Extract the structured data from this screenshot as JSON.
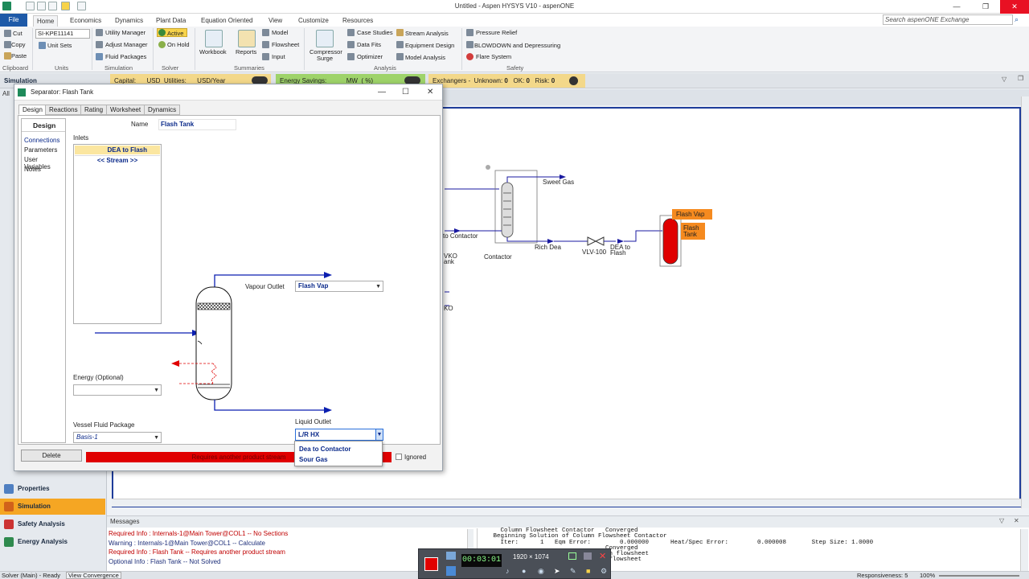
{
  "app": {
    "title": "Untitled - Aspen HYSYS V10 - aspenONE",
    "search_placeholder": "Search aspenONE Exchange"
  },
  "menu": {
    "tabs": [
      "File",
      "Home",
      "Economics",
      "Dynamics",
      "Plant Data",
      "Equation Oriented",
      "View",
      "Customize",
      "Resources"
    ]
  },
  "ribbon": {
    "clipboard": {
      "cut": "Cut",
      "copy": "Copy",
      "paste": "Paste",
      "group": "Clipboard"
    },
    "units": {
      "unit_set_value": "SI-KPE11141",
      "unit_sets": "Unit Sets",
      "group": "Units"
    },
    "simulation": {
      "utility_manager": "Utility Manager",
      "adjust_manager": "Adjust Manager",
      "fluid_packages": "Fluid Packages",
      "group": "Simulation"
    },
    "solver": {
      "active": "Active",
      "on_hold": "On Hold",
      "group": "Solver"
    },
    "summaries": {
      "workbook": "Workbook",
      "reports": "Reports",
      "model": "Model",
      "flowsheet": "Flowsheet",
      "input": "Input",
      "group": "Summaries"
    },
    "analysis": {
      "compressor": "Compressor",
      "surge": "Surge",
      "case_studies": "Case Studies",
      "data_fits": "Data Fits",
      "optimizer": "Optimizer",
      "stream_analysis": "Stream Analysis",
      "equipment_design": "Equipment Design",
      "model_analysis": "Model Analysis",
      "group": "Analysis"
    },
    "safety": {
      "pressure_relief": "Pressure Relief",
      "blowdown": "BLOWDOWN and Depressuring",
      "flare_system": "Flare System",
      "group": "Safety"
    }
  },
  "simbar": {
    "simulation": "Simulation",
    "capital": "Capital:",
    "capital_unit": "USD",
    "utilities": "Utilities:",
    "utilities_unit": "USD/Year",
    "energy_savings": "Energy Savings:",
    "energy_unit": "MW",
    "energy_pct": "(        %)",
    "exchangers": "Exchangers -",
    "unknown_label": "Unknown:",
    "unknown_val": "0",
    "ok_label": "OK:",
    "ok_val": "0",
    "risk_label": "Risk:",
    "risk_val": "0"
  },
  "leftnav": {
    "all": "All",
    "items": [
      "Properties",
      "Simulation",
      "Safety Analysis",
      "Energy Analysis"
    ]
  },
  "flowsheet": {
    "labels": {
      "sweet_gas": "Sweet Gas",
      "to_contactor": "to Contactor",
      "contactor": "Contactor",
      "rich_dea": "Rich Dea",
      "vlv": "VLV-100",
      "dea_to": "DEA to",
      "flash": "Flash",
      "flash_vap": "Flash Vap",
      "flash_tank_1": "Flash",
      "flash_tank_2": "Tank",
      "vko": "VKO",
      "ank": "ank",
      "ko": "KO"
    }
  },
  "dialog": {
    "title": "Separator: Flash Tank",
    "tabs": [
      "Design",
      "Reactions",
      "Rating",
      "Worksheet",
      "Dynamics"
    ],
    "nav_header": "Design",
    "nav_items": [
      "Connections",
      "Parameters",
      "User Variables",
      "Notes"
    ],
    "name_label": "Name",
    "name_value": "Flash Tank",
    "inlets_label": "Inlets",
    "inlets": [
      "DEA to Flash",
      "<< Stream >>"
    ],
    "vapour_outlet_label": "Vapour Outlet",
    "vapour_outlet_value": "Flash Vap",
    "energy_label": "Energy (Optional)",
    "energy_value": "",
    "fluid_package_label": "Vessel Fluid Package",
    "fluid_package_value": "Basis-1",
    "liquid_outlet_label": "Liquid Outlet",
    "liquid_outlet_value": "L/R HX",
    "dropdown_options": [
      "Dea to Contactor",
      "Sour Gas"
    ],
    "delete": "Delete",
    "status": "Requires another product stream",
    "ignored": "Ignored"
  },
  "messages": {
    "header": "Messages",
    "left": [
      {
        "text": "Required Info : Internals-1@Main Tower@COL1 -- No Sections",
        "kind": "red"
      },
      {
        "text": "Warning : Internals-1@Main Tower@COL1 -- Calculate",
        "kind": "normal"
      },
      {
        "text": "Required Info : Flash Tank -- Requires another product stream",
        "kind": "red"
      },
      {
        "text": "Optional Info : Flash Tank -- Not Solved",
        "kind": "normal"
      }
    ],
    "right": "     Column Flowsheet Contactor   Converged\n   Beginning Solution of Column Flowsheet Contactor\n     Iter:      1   Eqm Error:        0.000000      Heat/Spec Error:        0.000008       Step Size: 1.0000\n                                  Converged\n                       d on the Main flowsheet\n                       on the Main flowsheet"
  },
  "statusbar": {
    "solver": "Solver (Main) - Ready",
    "view_convergence": "View Convergence",
    "responsiveness": "Responsiveness: 5",
    "zoom": "100%"
  },
  "recorder": {
    "time": "00:03:01",
    "resolution": "1920 × 1074"
  },
  "colors": {
    "accent_blue": "#1e5aa8",
    "sim_active": "#f5a623",
    "status_red": "#e00000",
    "stream_blue": "#0b1fb0",
    "vessel_red": "#e00000",
    "label_orange": "#f58a1f"
  }
}
